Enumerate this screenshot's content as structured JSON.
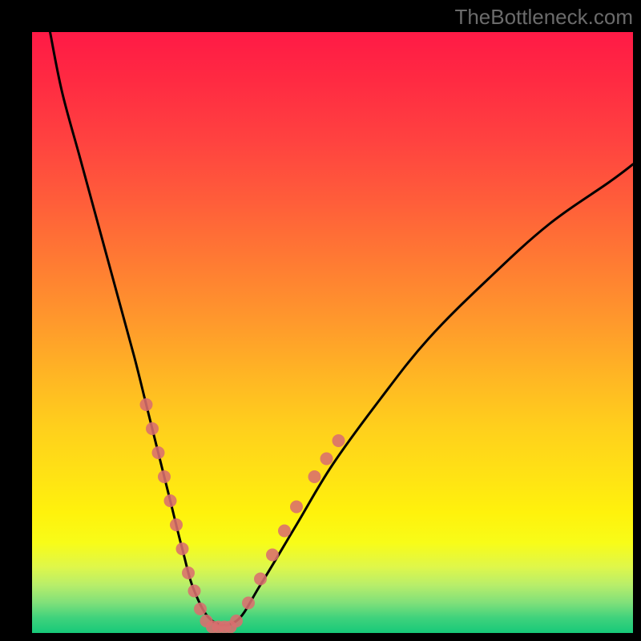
{
  "watermark": {
    "text": "TheBottleneck.com"
  },
  "chart_data": {
    "type": "line",
    "title": "",
    "xlabel": "",
    "ylabel": "",
    "xlim": [
      0,
      100
    ],
    "ylim": [
      0,
      100
    ],
    "grid": false,
    "legend": false,
    "background": "vertical-gradient-red-to-green",
    "series": [
      {
        "name": "bottleneck-curve",
        "color": "#000000",
        "x": [
          3,
          5,
          8,
          11,
          14,
          17,
          19,
          21,
          23,
          25,
          27,
          30,
          34,
          38,
          44,
          50,
          58,
          66,
          76,
          86,
          96,
          100
        ],
        "y": [
          100,
          90,
          79,
          68,
          57,
          46,
          38,
          30,
          22,
          14,
          7,
          2,
          2,
          8,
          18,
          28,
          39,
          49,
          59,
          68,
          75,
          78
        ]
      }
    ],
    "markers": {
      "name": "highlighted-points",
      "color": "#d96e6e",
      "radius_px": 8,
      "points": [
        {
          "x": 19,
          "y": 38
        },
        {
          "x": 20,
          "y": 34
        },
        {
          "x": 21,
          "y": 30
        },
        {
          "x": 22,
          "y": 26
        },
        {
          "x": 23,
          "y": 22
        },
        {
          "x": 24,
          "y": 18
        },
        {
          "x": 25,
          "y": 14
        },
        {
          "x": 26,
          "y": 10
        },
        {
          "x": 27,
          "y": 7
        },
        {
          "x": 28,
          "y": 4
        },
        {
          "x": 29,
          "y": 2
        },
        {
          "x": 30,
          "y": 1
        },
        {
          "x": 31,
          "y": 1
        },
        {
          "x": 32,
          "y": 1
        },
        {
          "x": 33,
          "y": 1
        },
        {
          "x": 34,
          "y": 2
        },
        {
          "x": 36,
          "y": 5
        },
        {
          "x": 38,
          "y": 9
        },
        {
          "x": 40,
          "y": 13
        },
        {
          "x": 42,
          "y": 17
        },
        {
          "x": 44,
          "y": 21
        },
        {
          "x": 47,
          "y": 26
        },
        {
          "x": 49,
          "y": 29
        },
        {
          "x": 51,
          "y": 32
        }
      ]
    }
  }
}
